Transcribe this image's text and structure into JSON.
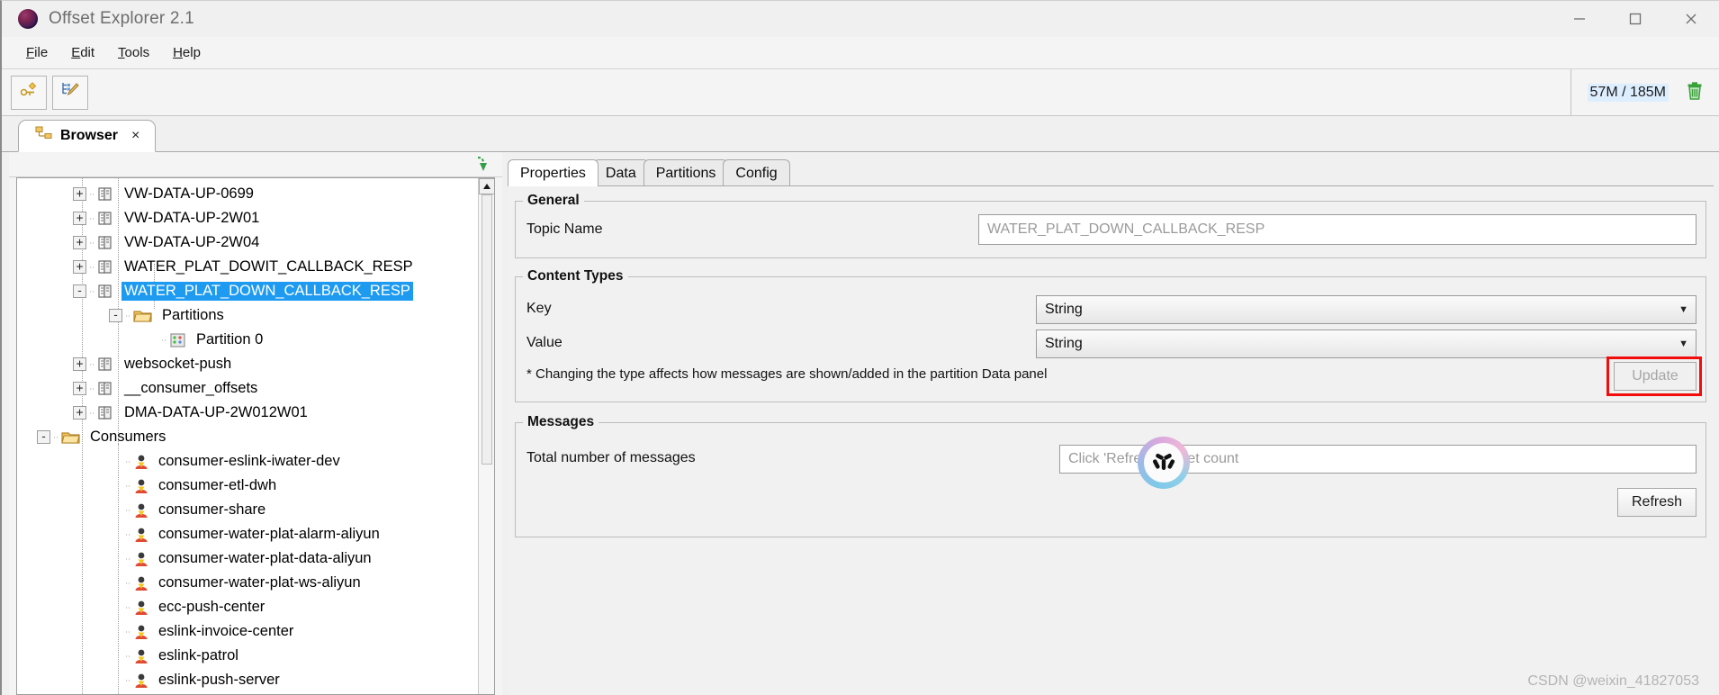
{
  "window": {
    "title": "Offset Explorer  2.1",
    "logo_icon": "offset-explorer-sphere-icon",
    "minimize": "minimize-icon",
    "maximize": "maximize-icon",
    "close": "close-icon"
  },
  "menu": {
    "items": [
      {
        "label": "File",
        "mnemonic": "F"
      },
      {
        "label": "Edit",
        "mnemonic": "E"
      },
      {
        "label": "Tools",
        "mnemonic": "T"
      },
      {
        "label": "Help",
        "mnemonic": "H"
      }
    ]
  },
  "toolbar": {
    "buttons": [
      {
        "name": "add-connection-button",
        "icon": "connect-plus-icon"
      },
      {
        "name": "edit-connection-button",
        "icon": "tree-edit-pencil-icon"
      }
    ],
    "memory": {
      "text": "57M / 185M",
      "used": "57M",
      "total": "185M",
      "gc_icon": "trash-can-icon",
      "gc_color": "#3aa03a"
    }
  },
  "tabs": {
    "browser": {
      "label": "Browser",
      "icon": "browser-tree-icon",
      "close": "×",
      "active": true
    }
  },
  "tree": {
    "sync_icon": "sync-down-arrow-icon",
    "scrollbar": {
      "up_arrow": "scroll-up-arrow-icon"
    },
    "nodes": [
      {
        "label": "VW-DATA-UP-0699",
        "indent": 1,
        "expander": "+",
        "icon": "topic-icon",
        "selected": false
      },
      {
        "label": "VW-DATA-UP-2W01",
        "indent": 1,
        "expander": "+",
        "icon": "topic-icon",
        "selected": false
      },
      {
        "label": "VW-DATA-UP-2W04",
        "indent": 1,
        "expander": "+",
        "icon": "topic-icon",
        "selected": false
      },
      {
        "label": "WATER_PLAT_DOWIT_CALLBACK_RESP",
        "indent": 1,
        "expander": "+",
        "icon": "topic-icon",
        "selected": false
      },
      {
        "label": "WATER_PLAT_DOWN_CALLBACK_RESP",
        "indent": 1,
        "expander": "-",
        "icon": "topic-icon",
        "selected": true
      },
      {
        "label": "Partitions",
        "indent": 2,
        "expander": "-",
        "icon": "folder-icon",
        "selected": false
      },
      {
        "label": "Partition 0",
        "indent": 3,
        "expander": "",
        "icon": "partition-icon",
        "selected": false
      },
      {
        "label": "websocket-push",
        "indent": 1,
        "expander": "+",
        "icon": "topic-icon",
        "selected": false
      },
      {
        "label": "__consumer_offsets",
        "indent": 1,
        "expander": "+",
        "icon": "topic-icon",
        "selected": false
      },
      {
        "label": "DMA-DATA-UP-2W012W01",
        "indent": 1,
        "expander": "+",
        "icon": "topic-icon",
        "selected": false
      },
      {
        "label": "Consumers",
        "indent": 0,
        "expander": "-",
        "icon": "folder-icon",
        "selected": false
      },
      {
        "label": "consumer-eslink-iwater-dev",
        "indent": 2,
        "expander": "",
        "icon": "consumer-icon",
        "selected": false
      },
      {
        "label": "consumer-etl-dwh",
        "indent": 2,
        "expander": "",
        "icon": "consumer-icon",
        "selected": false
      },
      {
        "label": "consumer-share",
        "indent": 2,
        "expander": "",
        "icon": "consumer-icon",
        "selected": false
      },
      {
        "label": "consumer-water-plat-alarm-aliyun",
        "indent": 2,
        "expander": "",
        "icon": "consumer-icon",
        "selected": false
      },
      {
        "label": "consumer-water-plat-data-aliyun",
        "indent": 2,
        "expander": "",
        "icon": "consumer-icon",
        "selected": false
      },
      {
        "label": "consumer-water-plat-ws-aliyun",
        "indent": 2,
        "expander": "",
        "icon": "consumer-icon",
        "selected": false
      },
      {
        "label": "ecc-push-center",
        "indent": 2,
        "expander": "",
        "icon": "consumer-icon",
        "selected": false
      },
      {
        "label": "eslink-invoice-center",
        "indent": 2,
        "expander": "",
        "icon": "consumer-icon",
        "selected": false
      },
      {
        "label": "eslink-patrol",
        "indent": 2,
        "expander": "",
        "icon": "consumer-icon",
        "selected": false
      },
      {
        "label": "eslink-push-server",
        "indent": 2,
        "expander": "",
        "icon": "consumer-icon",
        "selected": false
      }
    ]
  },
  "detail": {
    "tabs": [
      {
        "label": "Properties",
        "active": true
      },
      {
        "label": "Data",
        "active": false
      },
      {
        "label": "Partitions",
        "active": false
      },
      {
        "label": "Config",
        "active": false
      }
    ],
    "general": {
      "title": "General",
      "topic_name_label": "Topic Name",
      "topic_name_value": "WATER_PLAT_DOWN_CALLBACK_RESP"
    },
    "content_types": {
      "title": "Content Types",
      "key_label": "Key",
      "key_value": "String",
      "value_label": "Value",
      "value_value": "String",
      "hint": "* Changing the type affects how messages are shown/added in the partition Data panel",
      "update_label": "Update",
      "update_disabled": true
    },
    "messages": {
      "title": "Messages",
      "total_label": "Total number of messages",
      "total_placeholder": "Click 'Refresh' to get count",
      "total_value": "",
      "refresh_label": "Refresh"
    }
  },
  "annotation": {
    "highlight_color": "#f20c0c",
    "arrow_target": "update-button",
    "round_logo_icon": "tri-radial-logo-icon"
  },
  "watermark": {
    "text": "CSDN @weixin_41827053"
  }
}
